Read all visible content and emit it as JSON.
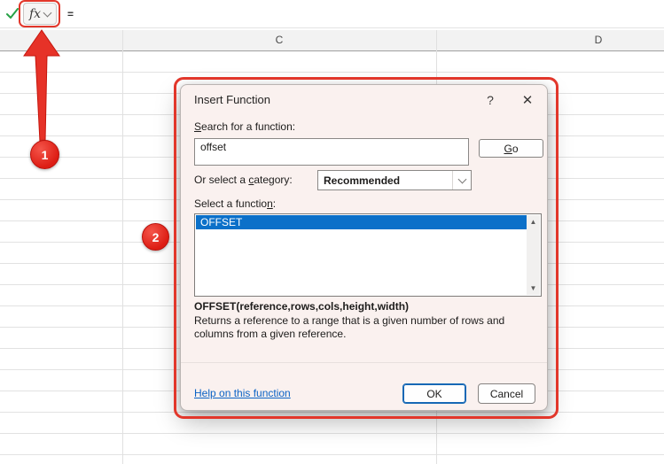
{
  "colors": {
    "accent": "#e2372b",
    "selection": "#0b70c9",
    "link": "#0b63c5",
    "check_green": "#27a146"
  },
  "formula_bar": {
    "fx_label": "fx",
    "formula_value": "="
  },
  "grid": {
    "columns": [
      "C",
      "D"
    ]
  },
  "annotations": {
    "step1": "1",
    "step2": "2"
  },
  "icons": {
    "help": "?",
    "close": "✕",
    "scroll_up": "▲",
    "scroll_down": "▼"
  },
  "dialog": {
    "title": "Insert Function",
    "search_label": {
      "key": "S",
      "post": "earch for a function:"
    },
    "search_value": "offset",
    "go": {
      "key": "G",
      "post": "o"
    },
    "category_label": {
      "pre": "Or select a ",
      "key": "c",
      "post": "ategory:"
    },
    "category_value": "Recommended",
    "select_label": {
      "pre": "Select a functio",
      "key": "n",
      "post": ":"
    },
    "functions": [
      "OFFSET"
    ],
    "signature": "OFFSET(reference,rows,cols,height,width)",
    "description": "Returns a reference to a range that is a given number of rows and columns from a given reference.",
    "help_link": "Help on this function",
    "ok": "OK",
    "cancel": "Cancel"
  }
}
